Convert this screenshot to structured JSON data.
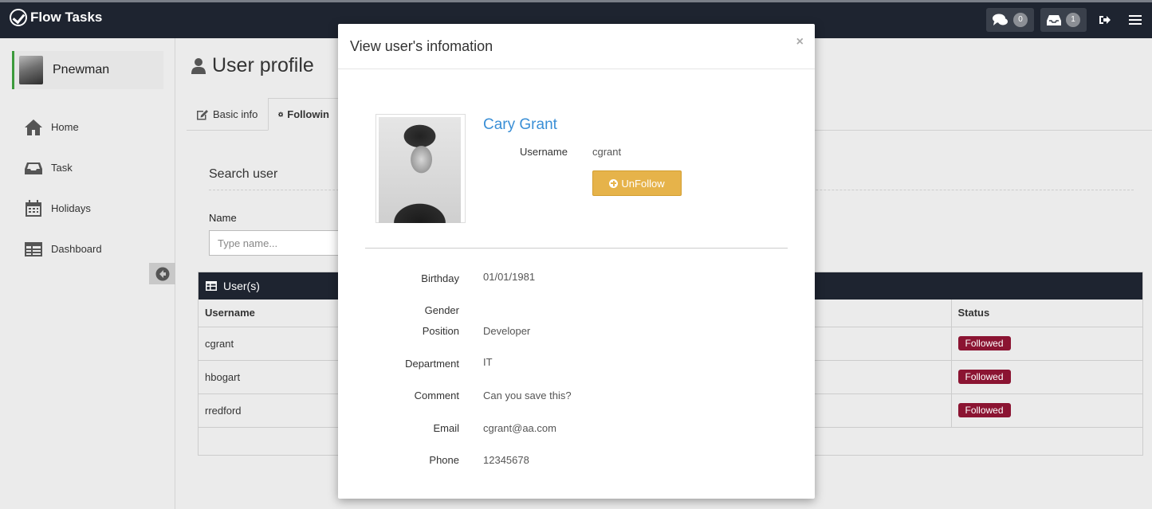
{
  "app": {
    "brand": "Flow Tasks"
  },
  "navbar": {
    "messages_count": "0",
    "inbox_count": "1",
    "icons": [
      "comments-icon",
      "inbox-icon",
      "sign-out-icon",
      "menu-icon"
    ]
  },
  "sidebar": {
    "user_name": "Pnewman",
    "items": [
      {
        "label": "Home",
        "icon": "home-icon"
      },
      {
        "label": "Task",
        "icon": "inbox-icon"
      },
      {
        "label": "Holidays",
        "icon": "calendar-icon"
      },
      {
        "label": "Dashboard",
        "icon": "table-icon"
      }
    ]
  },
  "page": {
    "title": "User profile",
    "tabs": [
      {
        "label": "Basic info",
        "icon": "edit-icon"
      },
      {
        "label": "Followin",
        "icon": "gear-icon"
      }
    ],
    "search": {
      "title": "Search user",
      "name_label": "Name",
      "name_placeholder": "Type name..."
    },
    "users_panel": {
      "title": "User(s)",
      "columns": [
        "Username",
        "Status"
      ],
      "rows": [
        {
          "username": "cgrant",
          "status": "Followed"
        },
        {
          "username": "hbogart",
          "status": "Followed"
        },
        {
          "username": "rredford",
          "status": "Followed"
        }
      ]
    }
  },
  "modal": {
    "title": "View user's infomation",
    "close": "×",
    "name": "Cary Grant",
    "username_label": "Username",
    "username": "cgrant",
    "unfollow_label": "UnFollow",
    "details": [
      {
        "label": "Birthday",
        "value": "01/01/1981"
      },
      {
        "label": "Gender",
        "value": ""
      },
      {
        "label": "Position",
        "value": "Developer"
      },
      {
        "label": "Department",
        "value": "IT"
      },
      {
        "label": "Comment",
        "value": "Can you save this?"
      },
      {
        "label": "Email",
        "value": "cgrant@aa.com"
      },
      {
        "label": "Phone",
        "value": "12345678"
      }
    ]
  },
  "colors": {
    "navbar": "#1e2430",
    "accent_link": "#3a8fd6",
    "warning_button": "#e6b34a",
    "followed_badge": "#8b1432"
  }
}
